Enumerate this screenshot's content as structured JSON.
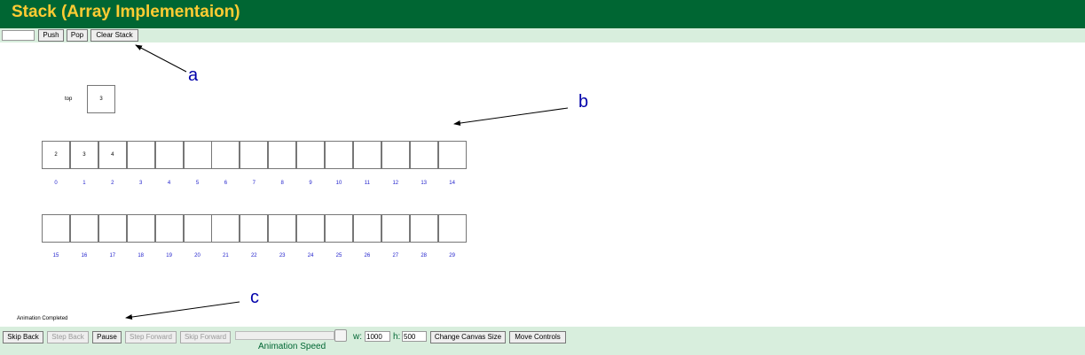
{
  "header": {
    "title": "Stack (Array Implementaion)"
  },
  "toolbar": {
    "input_value": "",
    "push_label": "Push",
    "pop_label": "Pop",
    "clear_label": "Clear Stack"
  },
  "stack": {
    "top_label": "top",
    "top_value": "3",
    "row1_values": [
      "2",
      "3",
      "4",
      "",
      "",
      "",
      "",
      "",
      "",
      "",
      "",
      "",
      "",
      "",
      ""
    ],
    "row1_indices": [
      "0",
      "1",
      "2",
      "3",
      "4",
      "5",
      "6",
      "7",
      "8",
      "9",
      "10",
      "11",
      "12",
      "13",
      "14"
    ],
    "row2_values": [
      "",
      "",
      "",
      "",
      "",
      "",
      "",
      "",
      "",
      "",
      "",
      "",
      "",
      "",
      ""
    ],
    "row2_indices": [
      "15",
      "16",
      "17",
      "18",
      "19",
      "20",
      "21",
      "22",
      "23",
      "24",
      "25",
      "26",
      "27",
      "28",
      "29"
    ]
  },
  "status": {
    "text": "Animation Completed"
  },
  "annotations": {
    "a": "a",
    "b": "b",
    "c": "c"
  },
  "controls": {
    "skip_back": "Skip Back",
    "step_back": "Step Back",
    "pause": "Pause",
    "step_forward": "Step Forward",
    "skip_forward": "Skip Forward",
    "speed_label": "Animation Speed",
    "width_label": "w:",
    "width_value": "1000",
    "height_label": "h:",
    "height_value": "500",
    "change_canvas_size": "Change Canvas Size",
    "move_controls": "Move Controls"
  },
  "colors": {
    "header_bg": "#006633",
    "title": "#ffcc33",
    "panel_bg": "#d8eedd",
    "index_text": "#2222cc",
    "annotation": "#0000aa"
  }
}
